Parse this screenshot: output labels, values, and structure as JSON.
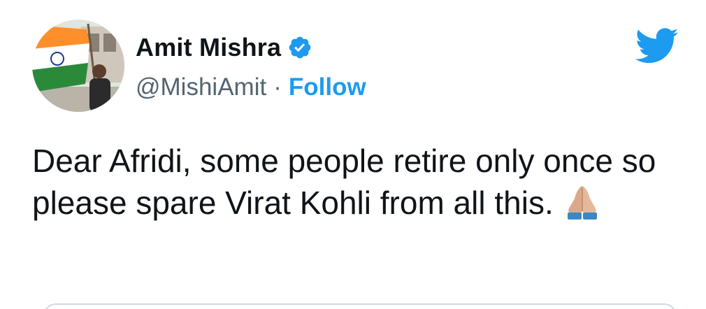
{
  "author": {
    "display_name": "Amit Mishra",
    "handle": "@MishiAmit",
    "separator": "·",
    "follow_label": "Follow",
    "verified": true,
    "avatar_icon": "avatar-flag-photo"
  },
  "tweet": {
    "text": "Dear Afridi, some people retire only once so please spare Virat Kohli from all this.",
    "emoji": "folded-hands-icon"
  },
  "icons": {
    "logo": "twitter-bird-icon",
    "badge": "verified-badge-icon"
  },
  "colors": {
    "accent": "#1d9bf0",
    "text": "#0f1419",
    "secondary": "#536471"
  }
}
